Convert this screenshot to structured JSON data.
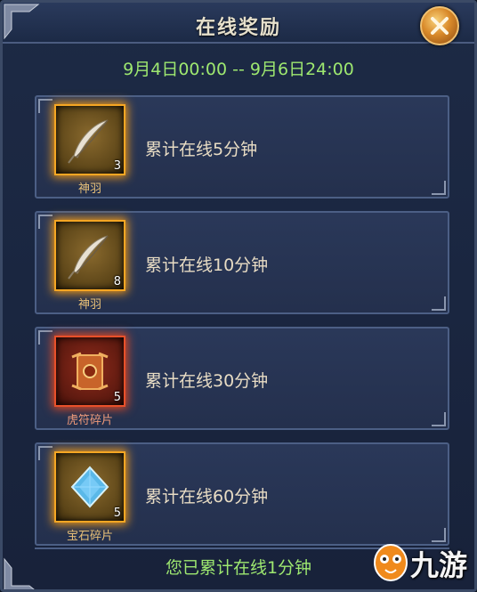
{
  "window": {
    "title": "在线奖励",
    "time_range": "9月4日00:00 -- 9月6日24:00"
  },
  "rewards": [
    {
      "item_name": "神羽",
      "count": "3",
      "requirement": "累计在线5分钟",
      "icon": "feather-icon",
      "frame_color": "#f5a623"
    },
    {
      "item_name": "神羽",
      "count": "8",
      "requirement": "累计在线10分钟",
      "icon": "feather-icon",
      "frame_color": "#f5a623"
    },
    {
      "item_name": "虎符碎片",
      "count": "5",
      "requirement": "累计在线30分钟",
      "icon": "tiger-tally-icon",
      "frame_color": "#e8502a"
    },
    {
      "item_name": "宝石碎片",
      "count": "5",
      "requirement": "累计在线60分钟",
      "icon": "gem-icon",
      "frame_color": "#f5a623"
    }
  ],
  "status": "您已累计在线1分钟",
  "watermark": {
    "text": "九游",
    "icon": "mascot-icon"
  },
  "colors": {
    "accent_green": "#9ee870",
    "gold": "#f5a623",
    "red_frame": "#e8502a"
  }
}
